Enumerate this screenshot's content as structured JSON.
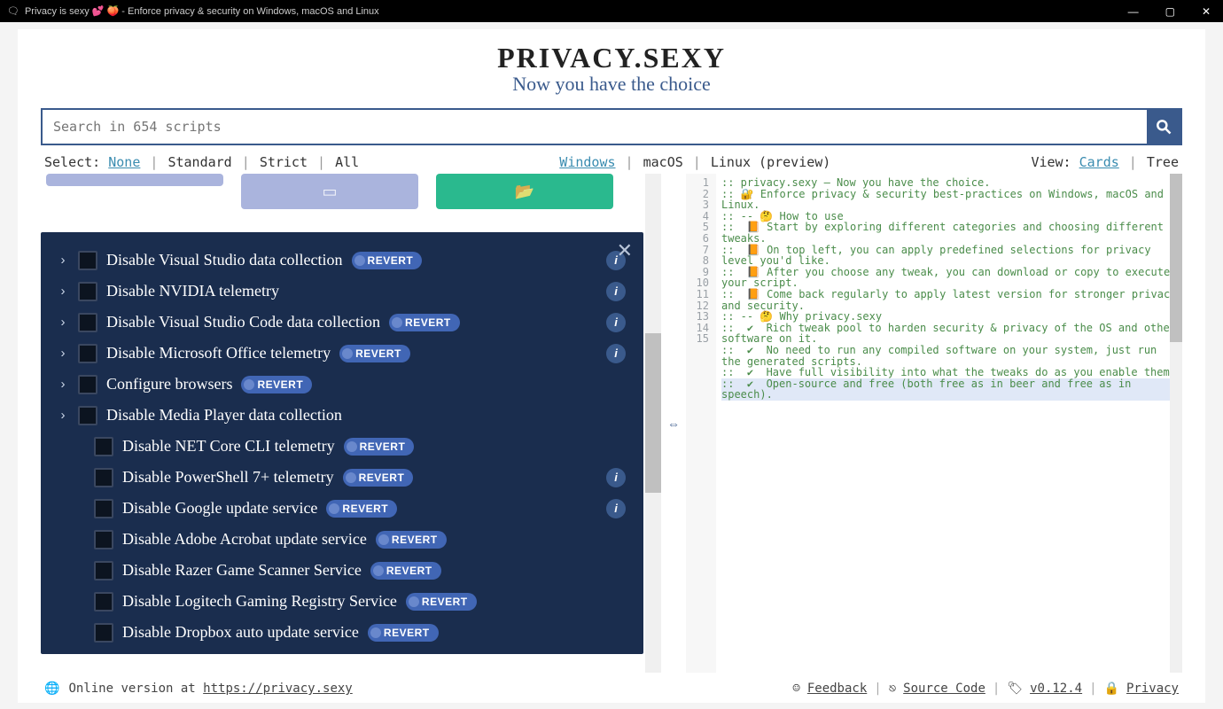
{
  "window_title": "Privacy is sexy 💕 🍑 - Enforce privacy & security on Windows, macOS and Linux",
  "brand": {
    "title": "PRIVACY.SEXY",
    "subtitle": "Now you have the choice"
  },
  "search": {
    "placeholder": "Search in 654 scripts"
  },
  "select_bar": {
    "label": "Select:",
    "options": [
      "None",
      "Standard",
      "Strict",
      "All"
    ],
    "active_index": 0
  },
  "os_bar": {
    "options": [
      "Windows",
      "macOS",
      "Linux (preview)"
    ],
    "active_index": 0
  },
  "view_bar": {
    "label": "View:",
    "options": [
      "Cards",
      "Tree"
    ],
    "active_index": 0
  },
  "tree_items": [
    {
      "label": "Disable Visual Studio data collection",
      "expandable": true,
      "revert": true,
      "info": true,
      "child": false
    },
    {
      "label": "Disable NVIDIA telemetry",
      "expandable": true,
      "revert": false,
      "info": true,
      "child": false
    },
    {
      "label": "Disable Visual Studio Code data collection",
      "expandable": true,
      "revert": true,
      "info": true,
      "child": false
    },
    {
      "label": "Disable Microsoft Office telemetry",
      "expandable": true,
      "revert": true,
      "info": true,
      "child": false
    },
    {
      "label": "Configure browsers",
      "expandable": true,
      "revert": true,
      "info": false,
      "child": false
    },
    {
      "label": "Disable Media Player data collection",
      "expandable": true,
      "revert": false,
      "info": false,
      "child": false
    },
    {
      "label": "Disable NET Core CLI telemetry",
      "expandable": false,
      "revert": true,
      "info": false,
      "child": true
    },
    {
      "label": "Disable PowerShell 7+ telemetry",
      "expandable": false,
      "revert": true,
      "info": true,
      "child": true
    },
    {
      "label": "Disable Google update service",
      "expandable": false,
      "revert": true,
      "info": true,
      "child": true
    },
    {
      "label": "Disable Adobe Acrobat update service",
      "expandable": false,
      "revert": true,
      "info": false,
      "child": true
    },
    {
      "label": "Disable Razer Game Scanner Service",
      "expandable": false,
      "revert": true,
      "info": false,
      "child": true
    },
    {
      "label": "Disable Logitech Gaming Registry Service",
      "expandable": false,
      "revert": true,
      "info": false,
      "child": true
    },
    {
      "label": "Disable Dropbox auto update service",
      "expandable": false,
      "revert": true,
      "info": false,
      "child": true
    }
  ],
  "revert_label": "REVERT",
  "code_lines": [
    ":: privacy.sexy — Now you have the choice.",
    ":: 🔐 Enforce privacy & security best-practices on Windows, macOS and Linux.",
    "",
    ":: -- 🤔 How to use",
    "::  📙 Start by exploring different categories and choosing different tweaks.",
    "::  📙 On top left, you can apply predefined selections for privacy level you'd like.",
    "::  📙 After you choose any tweak, you can download or copy to execute your script.",
    "::  📙 Come back regularly to apply latest version for stronger privacy and security.",
    "",
    ":: -- 🤔 Why privacy.sexy",
    "::  ✔  Rich tweak pool to harden security & privacy of the OS and other software on it.",
    "::  ✔  No need to run any compiled software on your system, just run the generated scripts.",
    "::  ✔  Have full visibility into what the tweaks do as you enable them.",
    "::  ✔  Open-source and free (both free as in beer and free as in speech)."
  ],
  "footer": {
    "left_text": "Online version at ",
    "left_link": "https://privacy.sexy",
    "links": [
      {
        "icon": "☺",
        "text": "Feedback"
      },
      {
        "icon": "⎋",
        "text": "Source Code"
      },
      {
        "icon": "🏷",
        "text": "v0.12.4"
      },
      {
        "icon": "🔒",
        "text": "Privacy"
      }
    ]
  }
}
